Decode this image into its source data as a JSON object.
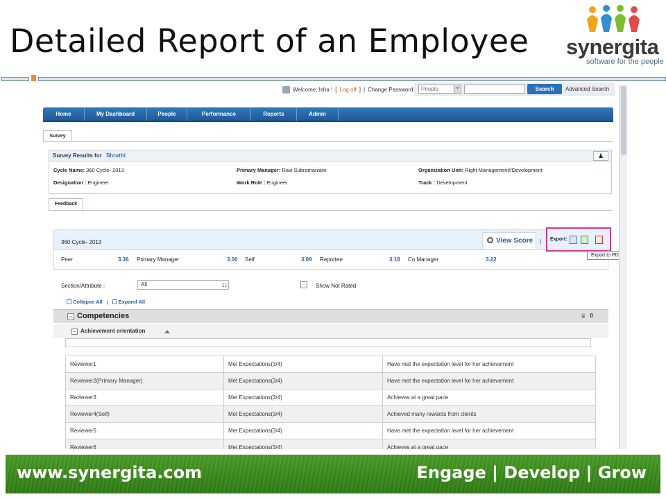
{
  "slide": {
    "title": "Detailed Report of an Employee",
    "logo_word": "synergita",
    "logo_tagline": "software for the people"
  },
  "topbar": {
    "welcome": "Welcome, Isha !",
    "open_bracket": "[",
    "logoff": "Log off",
    "close_bracket": "]",
    "separator": "|",
    "change_password": "Change Password",
    "search_scope": "People",
    "search_button": "Search",
    "advanced_search": "Advanced Search"
  },
  "nav": {
    "items": [
      {
        "label": "Home"
      },
      {
        "label": "My Dashboard"
      },
      {
        "label": "People"
      },
      {
        "label": "Performance"
      },
      {
        "label": "Reports"
      },
      {
        "label": "Admin"
      }
    ]
  },
  "tabs": {
    "survey": "Survey",
    "feedback": "Feedback"
  },
  "results": {
    "heading": "Survey Results for",
    "employee": "Shruthi",
    "cycle_name_label": "Cycle Name:",
    "cycle_name": "360 Cycle- 2013",
    "designation_label": "Designation :",
    "designation": "Engineer",
    "primary_manager_label": "Primary Manager:",
    "primary_manager": "Ravi Subramaniam",
    "work_role_label": "Work Role :",
    "work_role": "Engineer",
    "org_unit_label": "Organization Unit:",
    "org_unit": "Right Management//Development",
    "track_label": "Track :",
    "track": "Development"
  },
  "cycle": {
    "name": "360 Cycle- 2013",
    "view_score": "View Score",
    "export_label": "Export:",
    "export_tooltip": "Export to PDF",
    "pipe": "|"
  },
  "scores": [
    {
      "label": "Peer",
      "value": "3.36"
    },
    {
      "label": "Primary Manager",
      "value": "3.00"
    },
    {
      "label": "Self",
      "value": "3.09"
    },
    {
      "label": "Reportee",
      "value": "3.18"
    },
    {
      "label": "Co Manager",
      "value": "3.22"
    }
  ],
  "filter": {
    "label": "Section/Attribute :",
    "value": "All",
    "show_not_rated": "Show Not Rated"
  },
  "controls": {
    "collapse_all": "Collapse All",
    "separator": "|",
    "expand_all": "Expand All"
  },
  "competencies": {
    "title": "Competencies",
    "count": "0",
    "subsection": "Achievement orientation"
  },
  "reviews": [
    {
      "reviewer": "Reviewer1",
      "rating": "Met Expectations(3/4)",
      "comment": "Have met the expectation level for her achievement"
    },
    {
      "reviewer": "Reviewer2(Primary Manager)",
      "rating": "Met Expectations(3/4)",
      "comment": "Have met the expectation level for her achievement"
    },
    {
      "reviewer": "Reviewer3",
      "rating": "Met Expectations(3/4)",
      "comment": "Achieves at a great pace"
    },
    {
      "reviewer": "Reviewer4(Self)",
      "rating": "Met Expectations(3/4)",
      "comment": "Achieved many rewards from clients"
    },
    {
      "reviewer": "Reviewer5",
      "rating": "Met Expectations(3/4)",
      "comment": "Have met the expectation level for her achievement"
    },
    {
      "reviewer": "Reviewer6",
      "rating": "Met Expectations(3/4)",
      "comment": "Achieves at a great pace"
    }
  ],
  "footer": {
    "url": "www.synergita.com",
    "tagline": "Engage | Develop | Grow"
  },
  "colors": {
    "nav_blue": "#1f5a98",
    "accent_orange": "#f08a3a",
    "highlight_pink": "#d13a8a",
    "footer_green": "#3b8a1c"
  }
}
